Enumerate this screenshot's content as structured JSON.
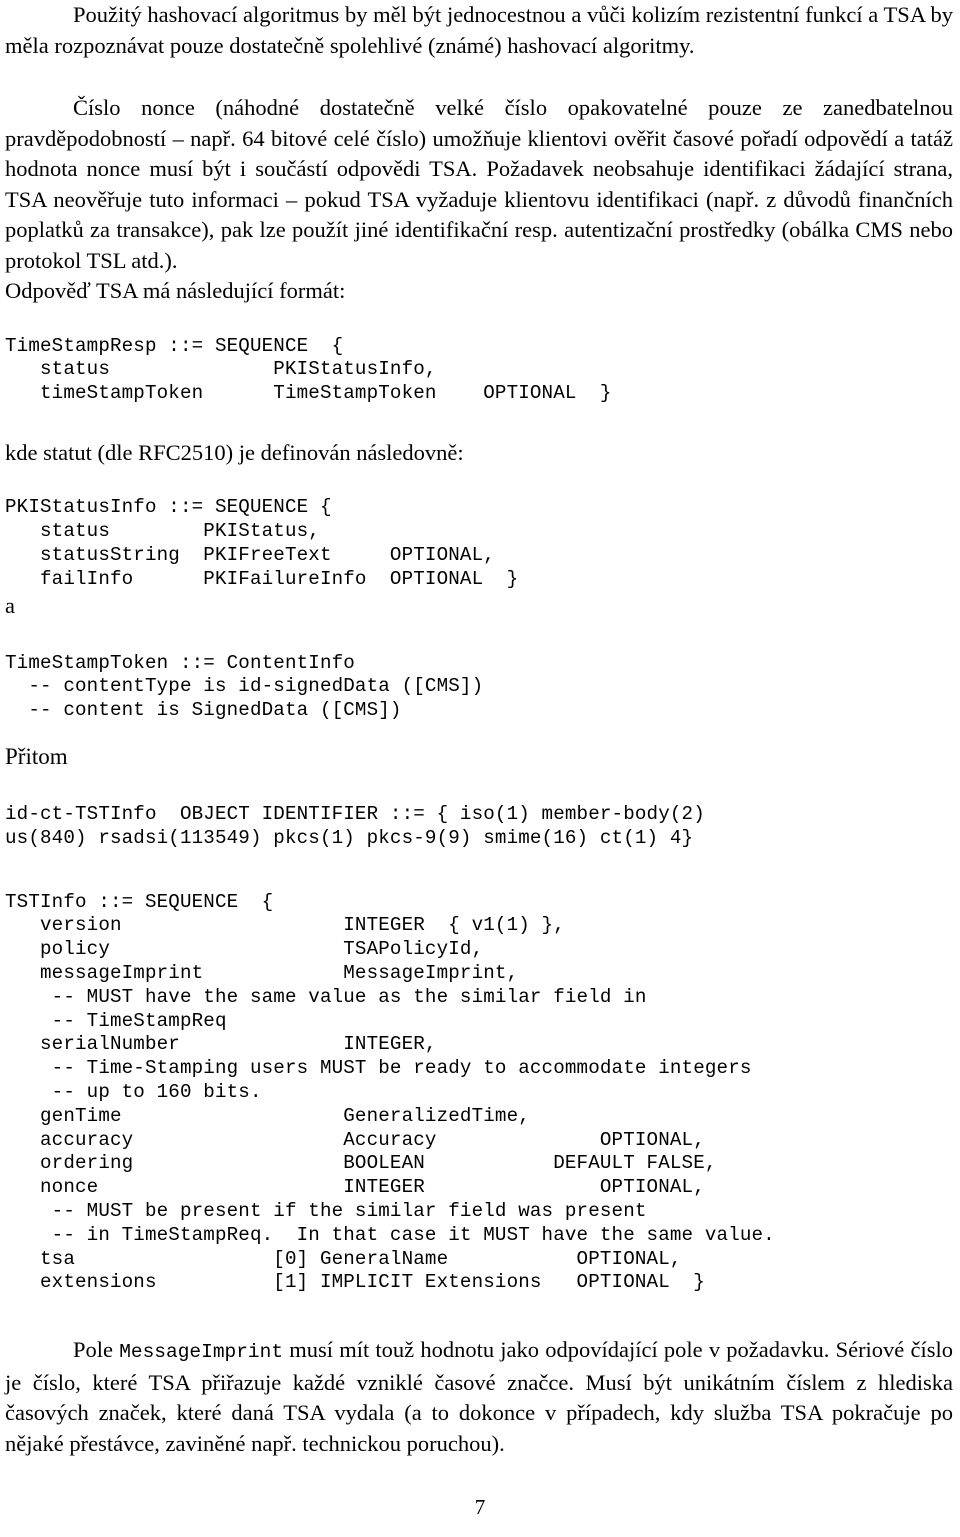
{
  "document": {
    "page_number": "7",
    "language": "cs"
  },
  "paragraphs": {
    "p1": "Použitý hashovací algoritmus by měl být jednocestnou a vůči kolizím rezistentní funkcí a TSA by měla rozpoznávat pouze dostatečně spolehlivé (známé) hashovací algoritmy.",
    "p2": "Číslo nonce (náhodné dostatečně velké číslo opakovatelné pouze ze zanedbatelnou pravděpodobností – např. 64 bitové celé číslo) umožňuje klientovi ověřit časové pořadí odpovědí a tatáž hodnota nonce musí být i součástí odpovědi TSA. Požadavek neobsahuje identifikaci žádající strana, TSA neověřuje tuto informaci – pokud TSA vyžaduje klientovu identifikaci (např. z důvodů finančních poplatků za transakce), pak lze použít jiné identifikační resp. autentizační prostředky (obálka CMS nebo protokol TSL atd.).",
    "p3": "Odpověď TSA má následující formát:",
    "p4": "kde statut (dle RFC2510) je definován následovně:",
    "lone_a": "a",
    "pritom": "Přitom",
    "p5_lead": "Pole ",
    "p5_mono": "MessageImprint",
    "p5_tail": " musí mít touž hodnotu jako odpovídající pole v požadavku. Sériové číslo je číslo, které TSA přiřazuje každé vzniklé časové značce. Musí být unikátním číslem z hlediska časových značek, které daná TSA vydala (a to dokonce v případech, kdy služba TSA pokračuje po nějaké přestávce, zaviněné např. technickou poruchou)."
  },
  "code_blocks": {
    "timestamp_resp": "TimeStampResp ::= SEQUENCE  {\n   status              PKIStatusInfo,\n   timeStampToken      TimeStampToken    OPTIONAL  }",
    "pki_status_info": "PKIStatusInfo ::= SEQUENCE {\n   status        PKIStatus,\n   statusString  PKIFreeText     OPTIONAL,\n   failInfo      PKIFailureInfo  OPTIONAL  }",
    "timestamp_token": "TimeStampToken ::= ContentInfo\n  -- contentType is id-signedData ([CMS])\n  -- content is SignedData ([CMS])",
    "id_ct_tstinfo": "id-ct-TSTInfo  OBJECT IDENTIFIER ::= { iso(1) member-body(2)\nus(840) rsadsi(113549) pkcs(1) pkcs-9(9) smime(16) ct(1) 4}",
    "tstinfo": "TSTInfo ::= SEQUENCE  {\n   version                   INTEGER  { v1(1) },\n   policy                    TSAPolicyId,\n   messageImprint            MessageImprint,\n    -- MUST have the same value as the similar field in\n    -- TimeStampReq\n   serialNumber              INTEGER,\n    -- Time-Stamping users MUST be ready to accommodate integers\n    -- up to 160 bits.\n   genTime                   GeneralizedTime,\n   accuracy                  Accuracy              OPTIONAL,\n   ordering                  BOOLEAN           DEFAULT FALSE,\n   nonce                     INTEGER               OPTIONAL,\n    -- MUST be present if the similar field was present\n    -- in TimeStampReq.  In that case it MUST have the same value.\n   tsa                 [0] GeneralName           OPTIONAL,\n   extensions          [1] IMPLICIT Extensions   OPTIONAL  }"
  },
  "colors": {
    "text": "#000000",
    "background": "#ffffff"
  }
}
